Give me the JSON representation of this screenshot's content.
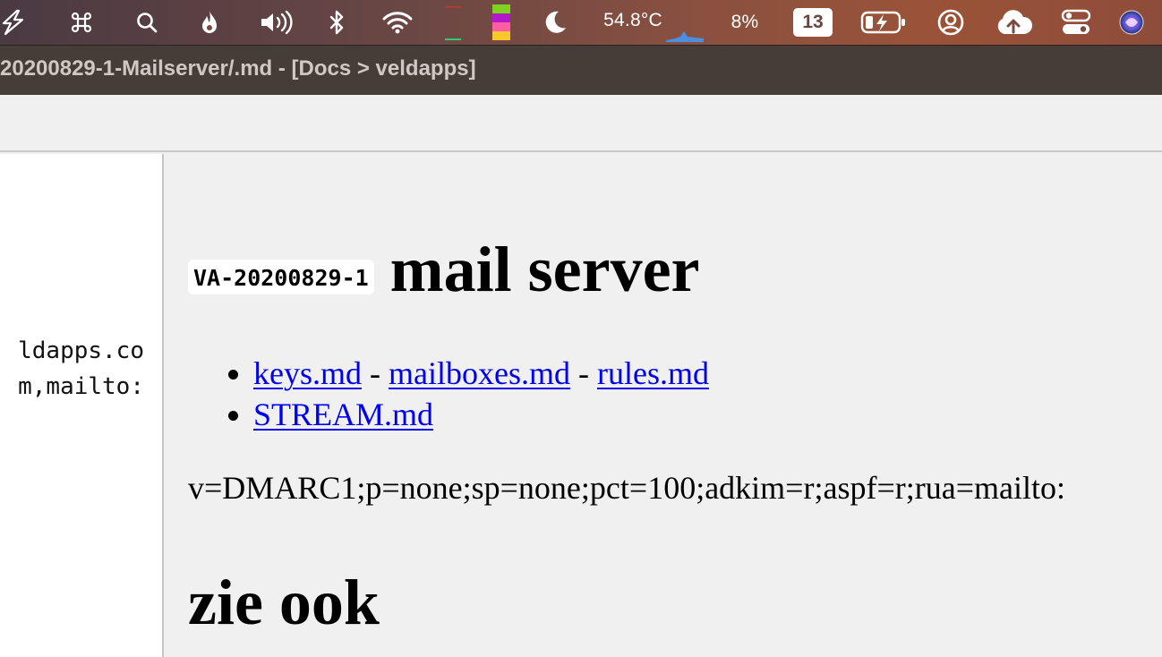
{
  "menubar": {
    "temperature": "54.8°C",
    "cpu_percent": "8%",
    "calendar_day": "13",
    "icons": [
      "bolt-app-icon",
      "command-icon",
      "search-icon",
      "flame-icon",
      "volume-icon",
      "bluetooth-icon",
      "wifi-icon",
      "activity-bars-icon",
      "color-blocks-icon",
      "moon-icon",
      "temp-graph-icon",
      "battery-charging-icon",
      "user-circle-icon",
      "cloud-upload-icon",
      "control-center-icon",
      "siri-icon"
    ]
  },
  "window": {
    "title": "20200829-1-Mailserver/.md - [Docs > veldapps]"
  },
  "sidebar": {
    "lines": [
      "ldapps.co",
      "m,mailto:"
    ]
  },
  "document": {
    "code_badge": "VA-20200829-1",
    "heading": "mail server",
    "list": [
      {
        "links": [
          "keys.md",
          "mailboxes.md",
          "rules.md"
        ],
        "separators": [
          " - ",
          " - "
        ]
      },
      {
        "links": [
          "STREAM.md"
        ]
      }
    ],
    "dmarc_record": "v=DMARC1;p=none;sp=none;pct=100;adkim=r;aspf=r;rua=mailto:",
    "heading2": "zie ook"
  }
}
